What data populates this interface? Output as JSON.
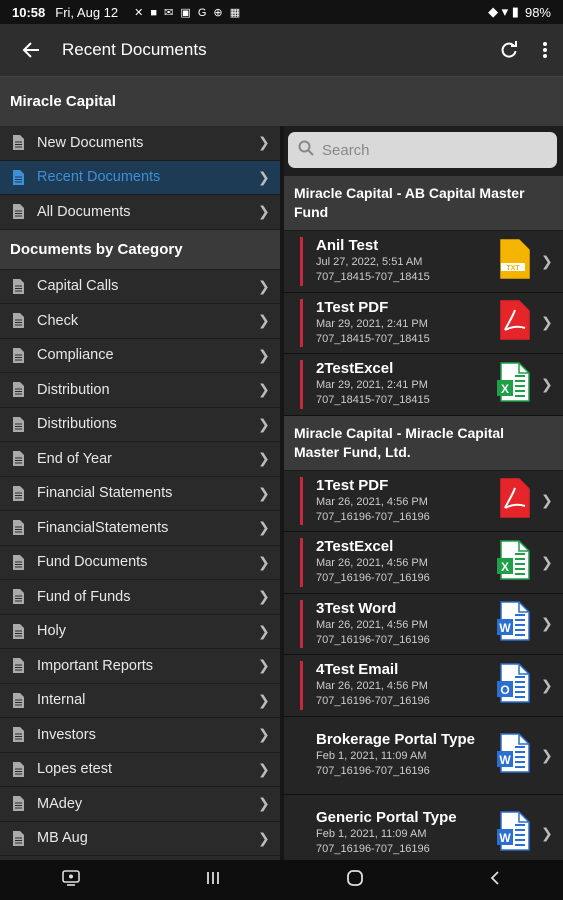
{
  "status": {
    "time": "10:58",
    "date": "Fri, Aug 12",
    "icons": "✕ ■ ✉ ▣ G ⊕ ▦",
    "right_icons": "◆ ▾ ▮",
    "battery": "98%"
  },
  "app_bar": {
    "title": "Recent Documents",
    "back_icon": "arrow-left-icon",
    "refresh_icon": "refresh-icon",
    "menu_icon": "more-vertical-icon"
  },
  "company": "Miracle Capital",
  "nav": [
    {
      "label": "New Documents",
      "selected": false
    },
    {
      "label": "Recent Documents",
      "selected": true
    },
    {
      "label": "All Documents",
      "selected": false
    }
  ],
  "category_header": "Documents by Category",
  "categories": [
    "Capital Calls",
    "Check",
    "Compliance",
    "Distribution",
    "Distributions",
    "End of Year",
    "Financial Statements",
    "FinancialStatements",
    "Fund Documents",
    "Fund of Funds",
    "Holy",
    "Important Reports",
    "Internal",
    "Investors",
    "Lopes etest",
    "MAdey",
    "MB Aug"
  ],
  "search": {
    "placeholder": "Search"
  },
  "groups": [
    {
      "title": "Miracle Capital - AB Capital Master Fund",
      "docs": [
        {
          "name": "Anil Test",
          "date": "Jul 27, 2022, 5:51 AM",
          "id": "707_18415-707_18415",
          "type": "txt",
          "flag": true
        },
        {
          "name": "1Test PDF",
          "date": "Mar 29, 2021, 2:41 PM",
          "id": "707_18415-707_18415",
          "type": "pdf",
          "flag": true
        },
        {
          "name": "2TestExcel",
          "date": "Mar 29, 2021, 2:41 PM",
          "id": "707_18415-707_18415",
          "type": "excel",
          "flag": true
        }
      ]
    },
    {
      "title": "Miracle Capital - Miracle Capital Master Fund, Ltd.",
      "docs": [
        {
          "name": "1Test PDF",
          "date": "Mar 26, 2021, 4:56 PM",
          "id": "707_16196-707_16196",
          "type": "pdf",
          "flag": true
        },
        {
          "name": "2TestExcel",
          "date": "Mar 26, 2021, 4:56 PM",
          "id": "707_16196-707_16196",
          "type": "excel",
          "flag": true
        },
        {
          "name": "3Test Word",
          "date": "Mar 26, 2021, 4:56 PM",
          "id": "707_16196-707_16196",
          "type": "word",
          "flag": true
        },
        {
          "name": "4Test Email",
          "date": "Mar 26, 2021, 4:56 PM",
          "id": "707_16196-707_16196",
          "type": "outlook",
          "flag": true
        },
        {
          "name": "Brokerage Portal Type",
          "date": "Feb 1, 2021, 11:09 AM",
          "id": "707_16196-707_16196",
          "type": "word",
          "flag": false
        },
        {
          "name": "Generic Portal Type",
          "date": "Feb 1, 2021, 11:09 AM",
          "id": "707_16196-707_16196",
          "type": "word",
          "flag": false
        }
      ]
    }
  ],
  "colors": {
    "accent": "#3d8fd6",
    "flag": "#c8283c",
    "pdf": "#e5252a",
    "excel": "#1e9f48",
    "word": "#2b6fd1",
    "txt": "#f5b400"
  },
  "bottom_nav": {
    "screenshot_icon": "screenshot-icon",
    "recents_icon": "recents-icon",
    "home_icon": "home-icon",
    "back_icon": "back-nav-icon"
  }
}
